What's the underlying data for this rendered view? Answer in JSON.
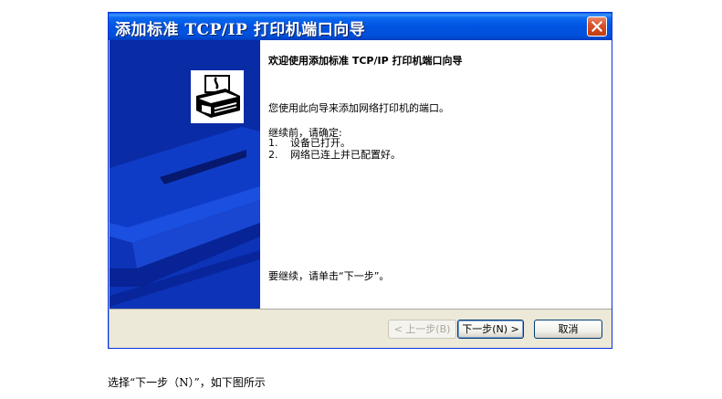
{
  "window": {
    "title": "添加标准 TCP/IP 打印机端口向导",
    "close_icon": "close-icon"
  },
  "banner": {
    "icon": "printer-wizard-icon"
  },
  "content": {
    "heading": "欢迎使用添加标准 TCP/IP 打印机端口向导",
    "intro": "您使用此向导来添加网络打印机的端口。",
    "before_label": "继续前，请确定:",
    "checklist": [
      {
        "num": "1.",
        "text": "设备已打开。"
      },
      {
        "num": "2.",
        "text": "网络已连上并已配置好。"
      }
    ],
    "continue_text": "要继续，请单击“下一步”。"
  },
  "footer": {
    "back_label": "< 上一步(B)",
    "next_label": "下一步(N) >",
    "cancel_label": "取消"
  },
  "caption": "选择“下一步（N）”，如下图所示",
  "colors": {
    "titlebar": "#0053e1",
    "banner": "#0a2ba6",
    "dialog_bg": "#ece9d8",
    "close_button": "#d9532c"
  }
}
